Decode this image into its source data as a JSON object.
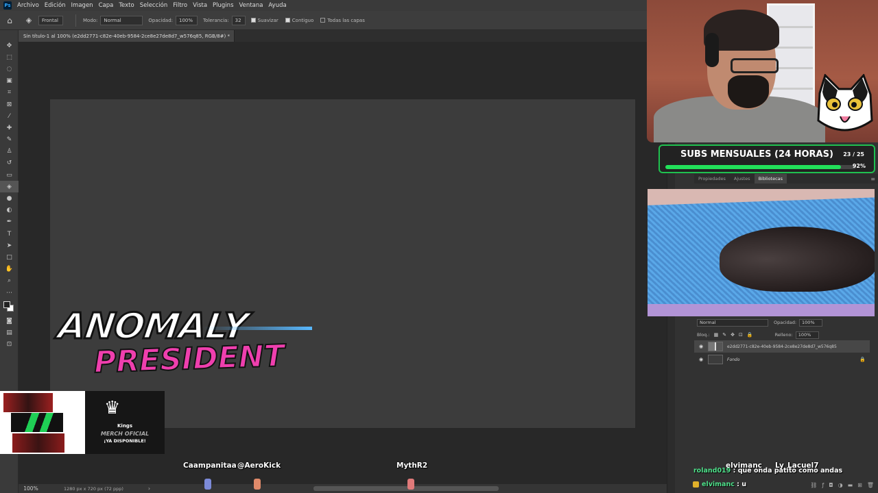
{
  "menubar": {
    "logo": "Ps",
    "items": [
      "Archivo",
      "Edición",
      "Imagen",
      "Capa",
      "Texto",
      "Selección",
      "Filtro",
      "Vista",
      "Plugins",
      "Ventana",
      "Ayuda"
    ]
  },
  "options": {
    "preset": "Frontal",
    "mode_label": "Modo:",
    "mode_value": "Normal",
    "opacity_label": "Opacidad:",
    "opacity_value": "100%",
    "tolerance_label": "Tolerancia:",
    "tolerance_value": "32",
    "smooth_label": "Suavizar",
    "contiguous_label": "Contiguo",
    "all_layers_label": "Todas las capas"
  },
  "document": {
    "tab_title": "Sin título-1 al 100% (e2dd2771-c82e-40eb-9584-2ce8e27de8d7_w576q85, RGB/8#) *"
  },
  "status": {
    "zoom": "100%",
    "size": "1280 px x 720 px (72 ppp)"
  },
  "panels": {
    "tabs": [
      "Propiedades",
      "Ajustes",
      "Bibliotecas"
    ],
    "active_tab": "Bibliotecas"
  },
  "layers": {
    "blend_mode": "Normal",
    "opacity_label": "Opacidad:",
    "opacity_value": "100%",
    "lock_label": "Bloq.:",
    "fill_label": "Relleno:",
    "fill_value": "100%",
    "items": [
      {
        "name": "e2dd2771-c82e-40eb-9584-2ce8e27de8d7_w576q85"
      },
      {
        "name": "Fondo"
      }
    ]
  },
  "stream": {
    "subs_title": "SUBS MENSUALES (24 HORAS)",
    "subs_count": "23 / 25",
    "subs_pct": "92%",
    "subs_fraction": 0.92,
    "accent": "#1fc14f",
    "logo_line1": "ANOMALY",
    "logo_line2": "PRESIDENT",
    "merch_brand": "Kings",
    "merch_line1": "MERCH OFICIAL",
    "merch_line2": "¡YA DISPONIBLE!",
    "viewers": [
      "Caampanitaa",
      "@AeroKick",
      "MythR2",
      "elvimanc",
      "Ly_Lacuel7"
    ],
    "chat": [
      {
        "user": "roland019",
        "sep": " : ",
        "msg": "que onda patito como andas"
      },
      {
        "user": "elvimanc",
        "sep": " : ",
        "msg": "u"
      }
    ]
  },
  "colors": {
    "brand_pink": "#ef3fae",
    "chat_user": "#4fe08a",
    "ps_blue": "#31a8ff"
  }
}
